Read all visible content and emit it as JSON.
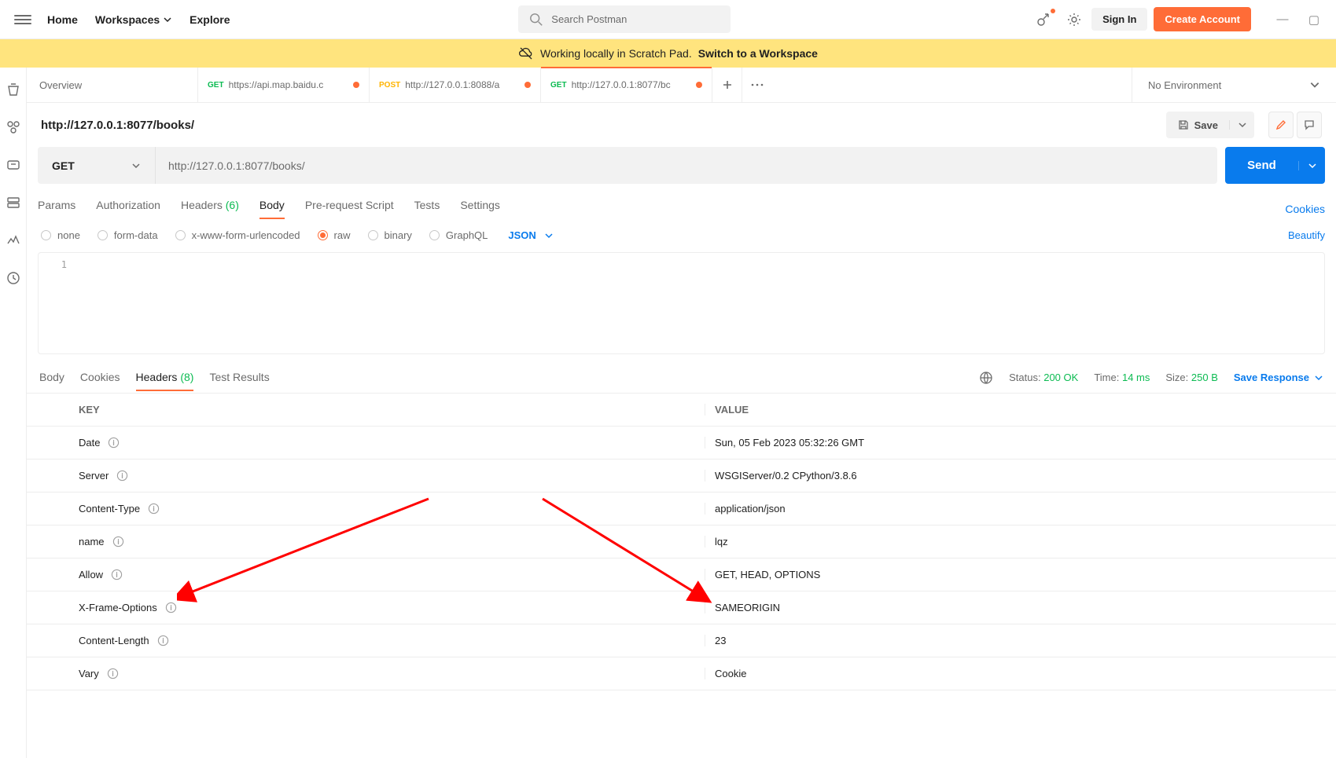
{
  "header": {
    "nav": {
      "home": "Home",
      "workspaces": "Workspaces",
      "explore": "Explore"
    },
    "search_placeholder": "Search Postman",
    "sign_in": "Sign In",
    "create_account": "Create Account"
  },
  "banner": {
    "msg": "Working locally in Scratch Pad.",
    "link": "Switch to a Workspace"
  },
  "tabs": {
    "overview": "Overview",
    "list": [
      {
        "method": "GET",
        "url": "https://api.map.baidu.c",
        "dirty": true,
        "active": false
      },
      {
        "method": "POST",
        "url": "http://127.0.0.1:8088/a",
        "dirty": true,
        "active": false
      },
      {
        "method": "GET",
        "url": "http://127.0.0.1:8077/bc",
        "dirty": true,
        "active": true
      }
    ],
    "env": "No Environment"
  },
  "request": {
    "title": "http://127.0.0.1:8077/books/",
    "save": "Save",
    "method": "GET",
    "url": "http://127.0.0.1:8077/books/",
    "send": "Send",
    "subTabs": {
      "params": "Params",
      "auth": "Authorization",
      "headers": "Headers",
      "headers_count": "(6)",
      "body": "Body",
      "prereq": "Pre-request Script",
      "tests": "Tests",
      "settings": "Settings",
      "cookies": "Cookies"
    },
    "bodyRadios": {
      "none": "none",
      "form": "form-data",
      "xwww": "x-www-form-urlencoded",
      "raw": "raw",
      "binary": "binary",
      "graphql": "GraphQL",
      "json": "JSON",
      "beautify": "Beautify"
    },
    "editor": {
      "line1": "1"
    }
  },
  "response": {
    "tabs": {
      "body": "Body",
      "cookies": "Cookies",
      "headers": "Headers",
      "headers_count": "(8)",
      "test_results": "Test Results"
    },
    "status_label": "Status:",
    "status_value": "200 OK",
    "time_label": "Time:",
    "time_value": "14 ms",
    "size_label": "Size:",
    "size_value": "250 B",
    "save_resp": "Save Response",
    "table": {
      "key_h": "KEY",
      "val_h": "VALUE",
      "rows": [
        {
          "k": "Date",
          "v": "Sun, 05 Feb 2023 05:32:26 GMT"
        },
        {
          "k": "Server",
          "v": "WSGIServer/0.2 CPython/3.8.6"
        },
        {
          "k": "Content-Type",
          "v": "application/json"
        },
        {
          "k": "name",
          "v": "lqz"
        },
        {
          "k": "Allow",
          "v": "GET, HEAD, OPTIONS"
        },
        {
          "k": "X-Frame-Options",
          "v": "SAMEORIGIN"
        },
        {
          "k": "Content-Length",
          "v": "23"
        },
        {
          "k": "Vary",
          "v": "Cookie"
        }
      ]
    }
  }
}
